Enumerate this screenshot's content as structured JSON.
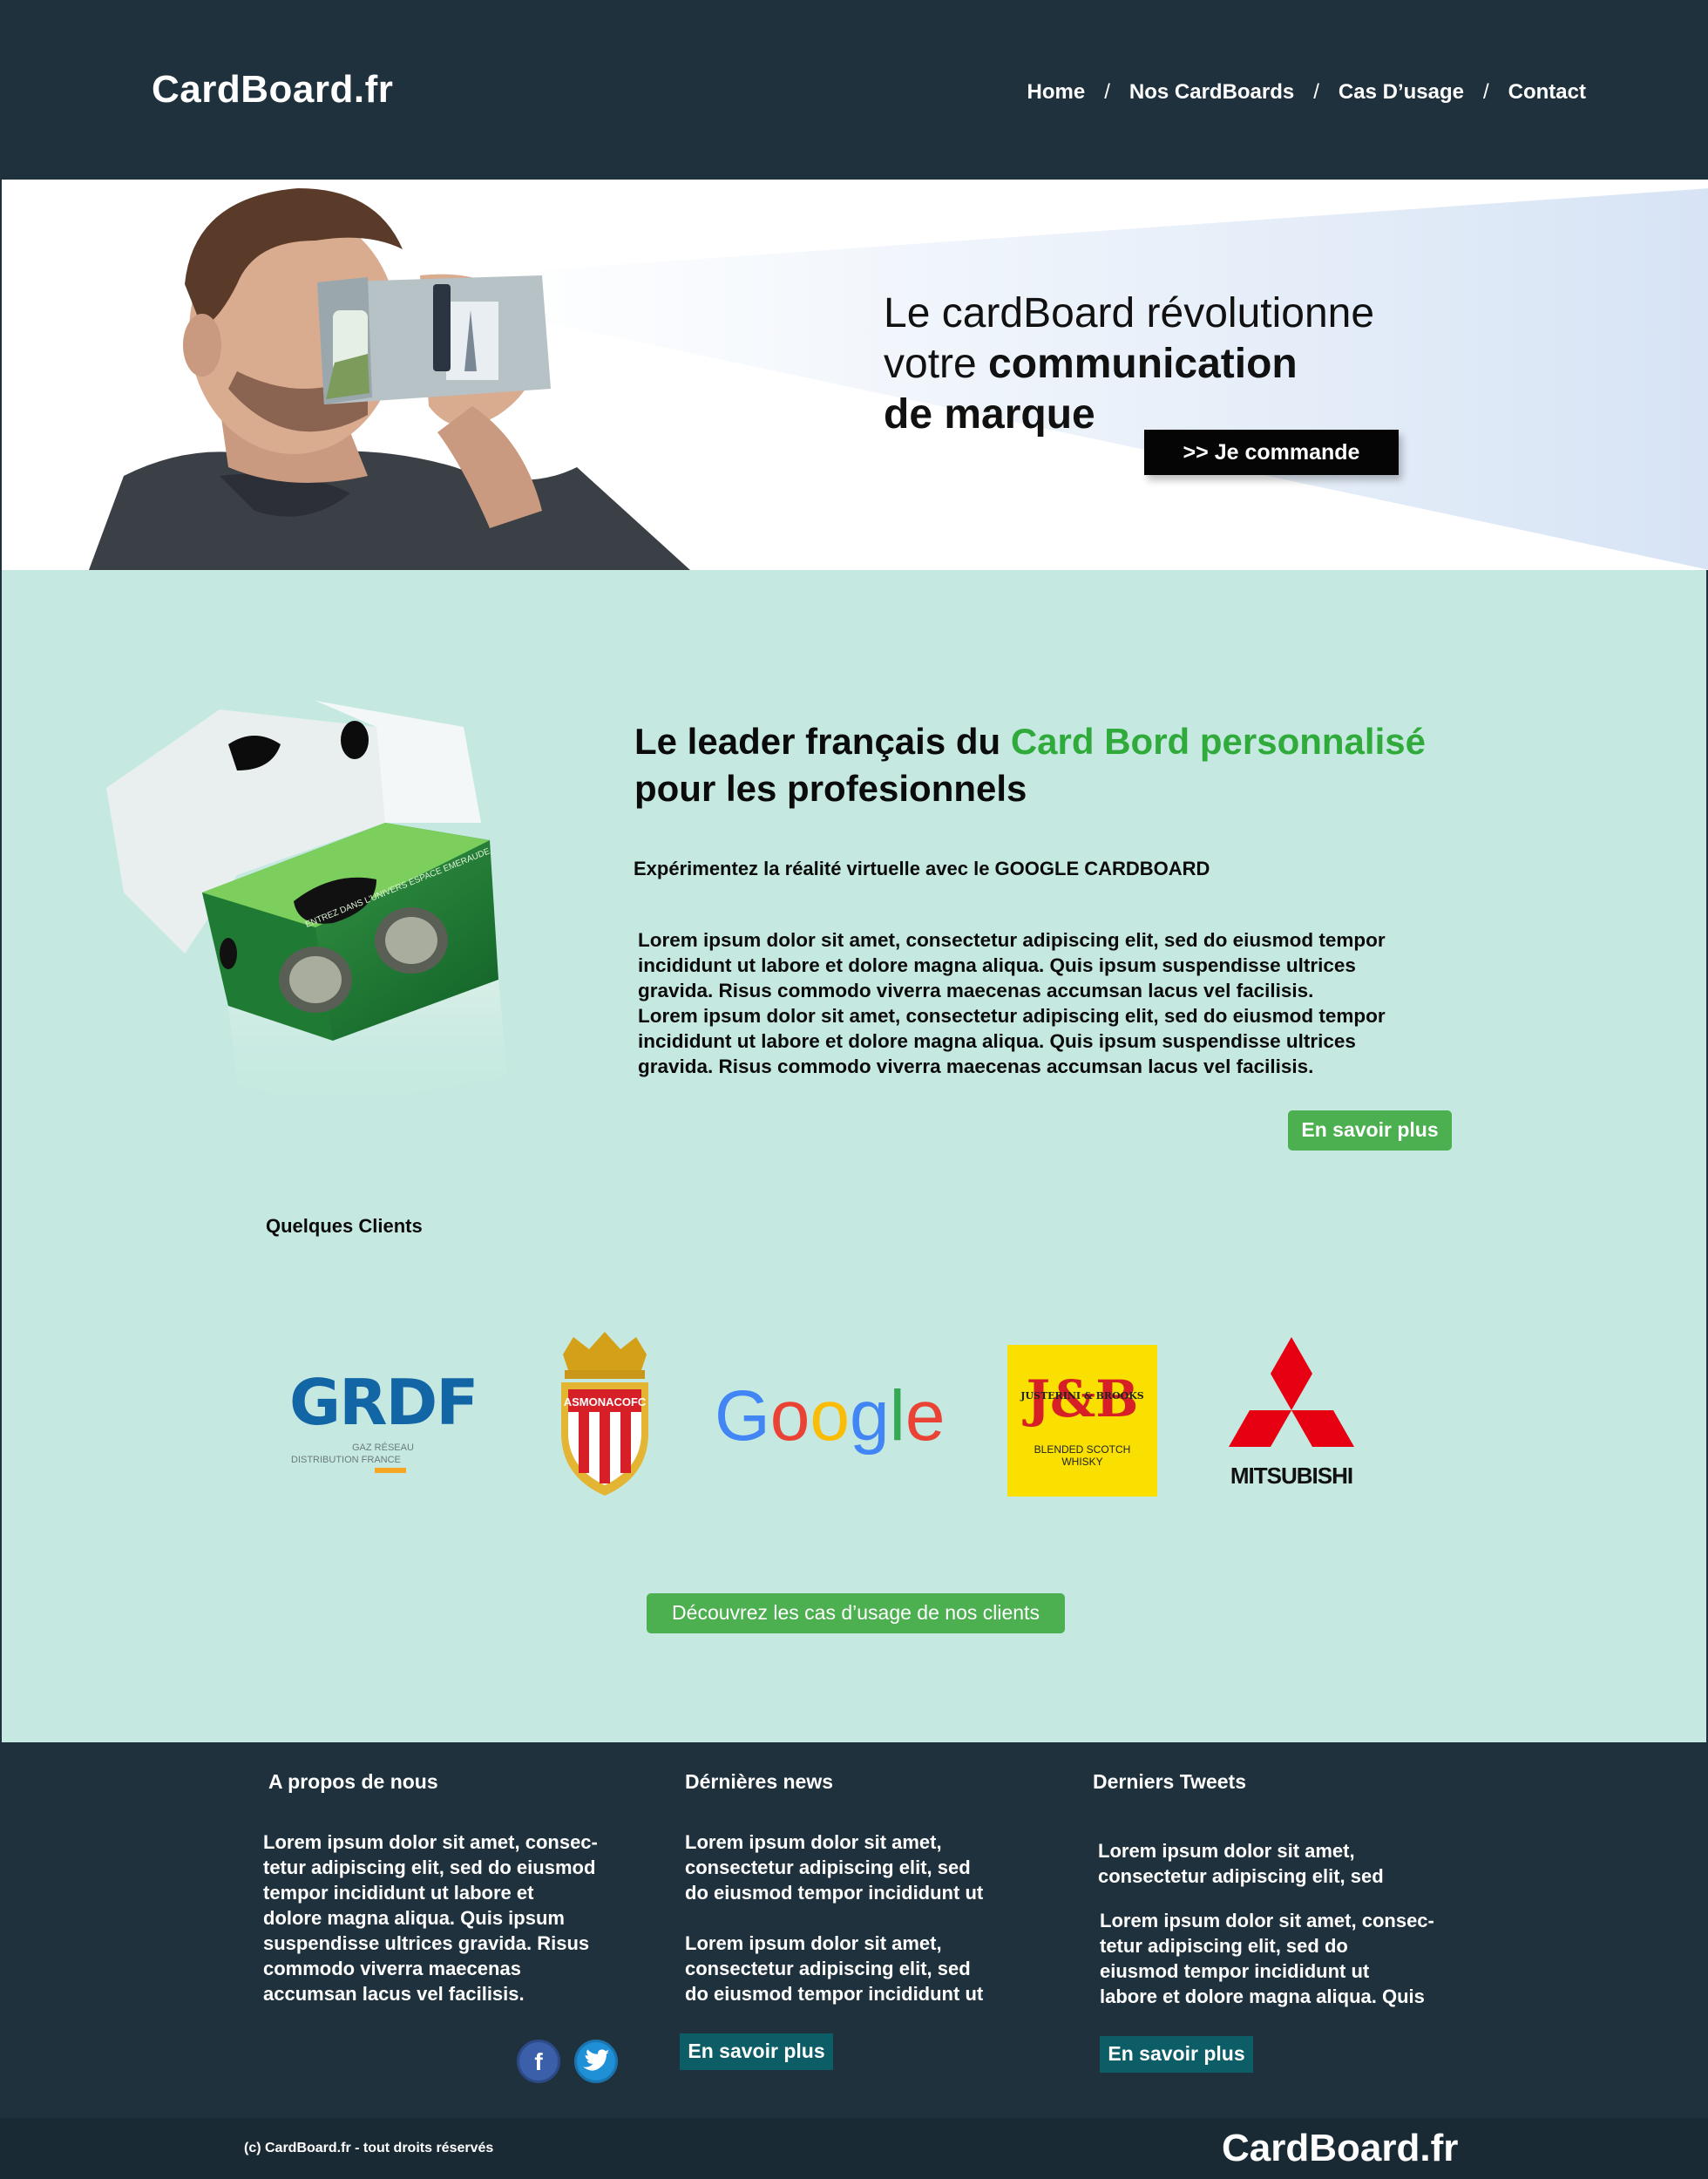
{
  "header": {
    "logo": "CardBoard.fr",
    "nav": [
      {
        "label": "Home"
      },
      {
        "label": "Nos CardBoards"
      },
      {
        "label": "Cas D’usage"
      },
      {
        "label": "Contact"
      }
    ],
    "separator": "/"
  },
  "hero": {
    "line1": "Le cardBoard révolutionne",
    "line2_plain": "votre ",
    "line2_bold": "communication",
    "line3_bold": "de marque",
    "cta": ">> Je commande"
  },
  "main": {
    "leader_plain": "Le leader français du ",
    "leader_green": "Card Bord personnalisé",
    "leader_line2": "pour les profesionnels",
    "subtitle": "Expérimentez la réalité virtuelle avec le GOOGLE CARDBOARD",
    "lorem_lines": [
      "Lorem ipsum dolor sit amet, consectetur adipiscing elit, sed do eiusmod tempor",
      "incididunt ut labore et dolore magna aliqua. Quis ipsum suspendisse ultrices",
      "gravida. Risus commodo viverra maecenas accumsan lacus vel facilisis.",
      "Lorem ipsum dolor sit amet, consectetur adipiscing elit, sed do eiusmod tempor",
      "incididunt ut labore et dolore magna aliqua. Quis ipsum suspendisse ultrices",
      "gravida. Risus commodo viverra maecenas accumsan lacus vel facilisis."
    ],
    "more_button": "En savoir plus",
    "clients_title": "Quelques Clients",
    "clients": {
      "grdf": {
        "name": "GRDF",
        "tagline1": "GAZ RÉSEAU",
        "tagline2": "DISTRIBUTION FRANCE"
      },
      "monaco": {
        "name": "ASMONACOFC"
      },
      "google": {
        "name": "Google"
      },
      "jb": {
        "name": "J&B",
        "brand": "JUSTERINI & BROOKS",
        "line1": "BLENDED SCOTCH",
        "line2": "WHISKY"
      },
      "mitsubishi": {
        "name": "MITSUBISHI"
      }
    },
    "cases_button": "Découvrez les cas d’usage de nos clients",
    "product_box_text": "ENTREZ DANS L'UNIVERS ESPACE EMERAUDE",
    "colors": {
      "accent_green": "#2faa3b",
      "button_green": "#4caf50",
      "background": "#c5e9e0"
    }
  },
  "footer": {
    "about": {
      "title": "A propos de nous",
      "lines": [
        "Lorem ipsum dolor sit amet, consec-",
        "tetur adipiscing elit, sed do eiusmod",
        "tempor incididunt ut labore et",
        "dolore magna aliqua. Quis ipsum",
        "suspendisse ultrices gravida. Risus",
        "commodo viverra maecenas",
        "accumsan lacus vel facilisis."
      ]
    },
    "news": {
      "title": "Dérnières news",
      "block1": [
        "Lorem ipsum dolor sit amet,",
        "consectetur adipiscing elit, sed",
        "do eiusmod tempor incididunt ut"
      ],
      "block2": [
        "Lorem ipsum dolor sit amet,",
        "consectetur adipiscing elit, sed",
        "do eiusmod tempor incididunt ut"
      ],
      "button": "En savoir plus"
    },
    "tweets": {
      "title": "Derniers Tweets",
      "block1": [
        "Lorem ipsum dolor sit amet,",
        "consectetur adipiscing elit, sed"
      ],
      "block2": [
        "Lorem ipsum dolor sit amet, consec-",
        "tetur adipiscing elit, sed do",
        "eiusmod tempor incididunt ut",
        "labore et dolore magna aliqua. Quis"
      ],
      "button": "En savoir plus"
    },
    "social": [
      {
        "icon": "facebook-icon",
        "glyph": "f"
      },
      {
        "icon": "twitter-icon"
      }
    ]
  },
  "bottom": {
    "copyright": "(c) CardBoard.fr - tout droits réservés",
    "logo": "CardBoard.fr"
  }
}
